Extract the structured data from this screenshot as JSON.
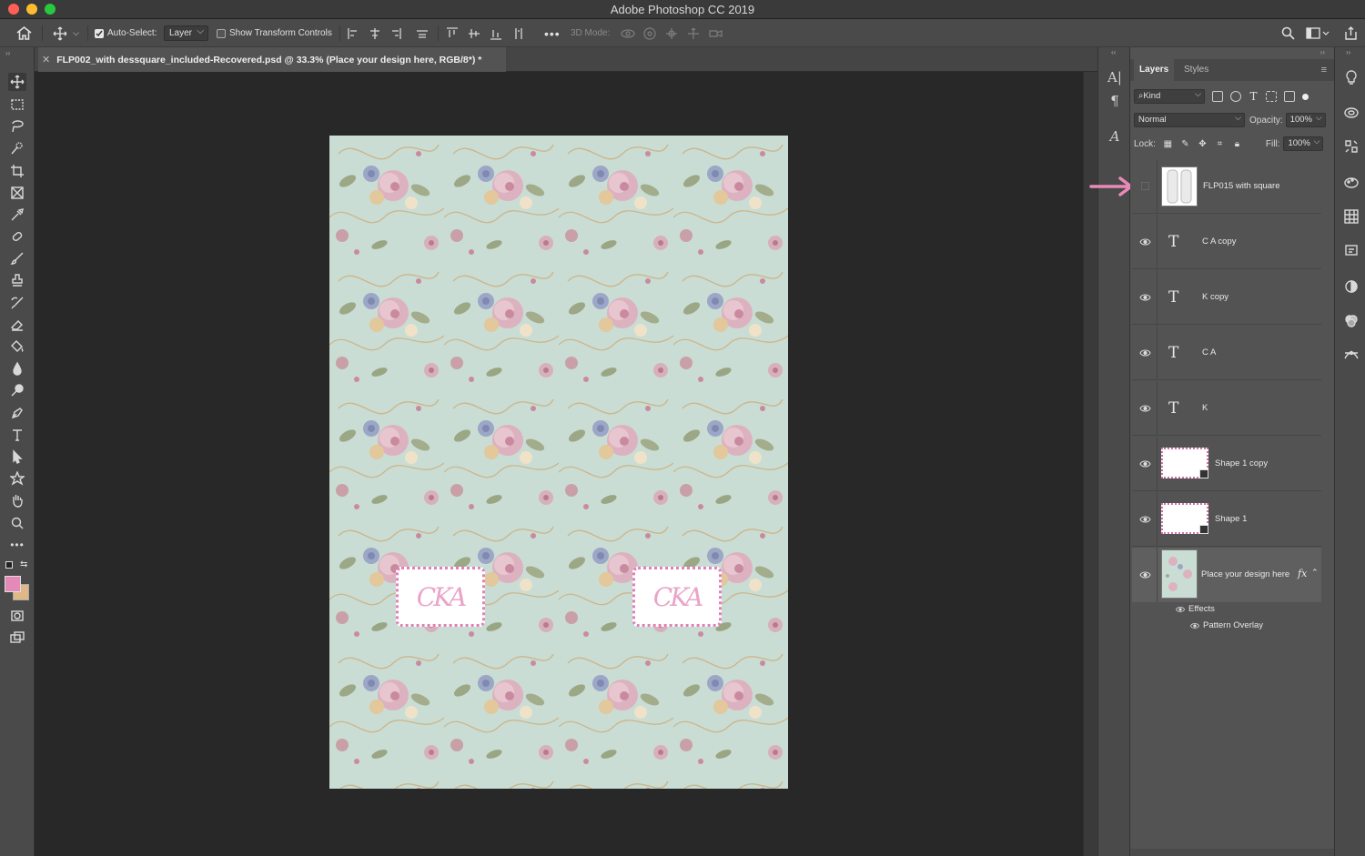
{
  "window": {
    "title": "Adobe Photoshop CC 2019"
  },
  "options_bar": {
    "auto_select_label": "Auto-Select:",
    "auto_select_checked": true,
    "auto_select_value": "Layer",
    "show_transform_label": "Show Transform Controls",
    "show_transform_checked": false,
    "three_d_mode_label": "3D Mode:"
  },
  "document": {
    "tab_title": "FLP002_with dessquare_included-Recovered.psd @ 33.3% (Place your design here, RGB/8*) *",
    "monogram_left": "CKA",
    "monogram_right": "CKA"
  },
  "layers_panel": {
    "tabs": [
      "Layers",
      "Styles"
    ],
    "filter_kind": "Kind",
    "blend_mode": "Normal",
    "opacity_label": "Opacity:",
    "opacity_value": "100%",
    "lock_label": "Lock:",
    "fill_label": "Fill:",
    "fill_value": "100%",
    "layers": [
      {
        "name": "FLP015 with square",
        "type": "smart",
        "visible": false
      },
      {
        "name": "C  A copy",
        "type": "text",
        "visible": true
      },
      {
        "name": "K copy",
        "type": "text",
        "visible": true
      },
      {
        "name": "C  A",
        "type": "text",
        "visible": true
      },
      {
        "name": "K",
        "type": "text",
        "visible": true
      },
      {
        "name": "Shape 1 copy",
        "type": "shape",
        "visible": true
      },
      {
        "name": "Shape 1",
        "type": "shape",
        "visible": true
      },
      {
        "name": "Place your design here",
        "type": "pattern",
        "visible": true,
        "selected": true,
        "fx": "fx"
      }
    ],
    "effects_label": "Effects",
    "effect_item": "Pattern Overlay"
  },
  "colors": {
    "foreground": "#e58ab8",
    "background": "#e0b888",
    "arrow": "#e98ab6",
    "canvas_base": "#c8dcd4"
  }
}
